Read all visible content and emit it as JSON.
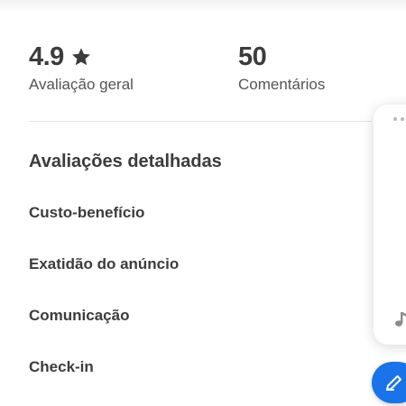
{
  "summary": {
    "rating_value": "4.9",
    "rating_label": "Avaliação geral",
    "comments_value": "50",
    "comments_label": "Comentários"
  },
  "detailed": {
    "title": "Avaliações detalhadas",
    "items": [
      {
        "label": "Custo-benefício"
      },
      {
        "label": "Exatidão do anúncio"
      },
      {
        "label": "Comunicação"
      },
      {
        "label": "Check-in"
      }
    ]
  },
  "icons": {
    "rating": "star-icon",
    "card_menu": "more-dots-icon",
    "card_media": "music-note-icon",
    "fab": "edit-icon"
  },
  "colors": {
    "text": "#3c3c3c",
    "fab": "#1a73e8"
  }
}
